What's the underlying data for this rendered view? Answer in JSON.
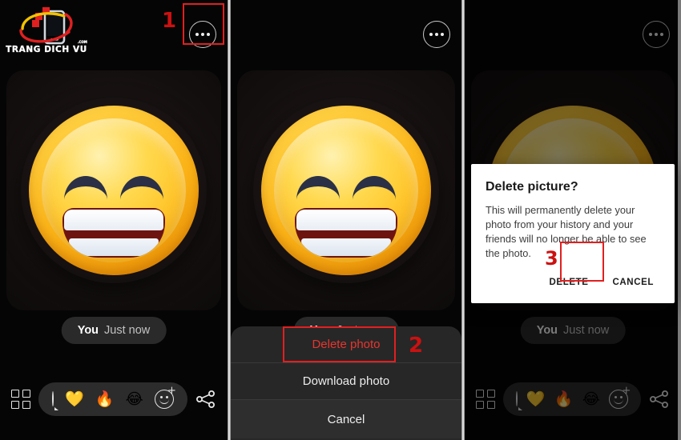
{
  "watermark": {
    "text": "TRANG DICH VU",
    "superscript": ".COM",
    "icon": "mobile-phone-logo"
  },
  "panels": [
    {
      "id": "panel-1",
      "step": "1",
      "menu_icon": "more-options-icon",
      "photo": {
        "alt": "grinning-face-with-smiling-eyes-emoji",
        "author": "You",
        "timestamp": "Just now"
      },
      "action_bar": {
        "grid_icon": "grid-view-icon",
        "reactions": [
          {
            "name": "comment-bubble-icon",
            "glyph": ""
          },
          {
            "name": "yellow-heart-reaction",
            "glyph": "💛"
          },
          {
            "name": "fire-reaction",
            "glyph": "🔥"
          },
          {
            "name": "joy-reaction",
            "glyph": "😂"
          },
          {
            "name": "add-reaction-icon",
            "glyph": ""
          }
        ],
        "share_icon": "share-icon"
      }
    },
    {
      "id": "panel-2",
      "step": "2",
      "menu_icon": "more-options-icon",
      "photo": {
        "alt": "grinning-face-with-smiling-eyes-emoji",
        "author": "You",
        "timestamp": "Just now"
      },
      "bottom_sheet": {
        "items": [
          {
            "label": "Delete photo",
            "style": "danger"
          },
          {
            "label": "Download photo",
            "style": "normal"
          },
          {
            "label": "Cancel",
            "style": "normal"
          }
        ]
      }
    },
    {
      "id": "panel-3",
      "step": "3",
      "menu_icon": "more-options-icon",
      "photo": {
        "alt": "grinning-face-with-smiling-eyes-emoji",
        "author": "You",
        "timestamp": "Just now"
      },
      "dialog": {
        "title": "Delete picture?",
        "body": "This will permanently delete your photo from your history and your friends will no longer be able to see the photo.",
        "confirm_label": "DELETE",
        "cancel_label": "CANCEL"
      },
      "action_bar": {
        "grid_icon": "grid-view-icon",
        "reactions": [
          {
            "name": "comment-bubble-icon",
            "glyph": ""
          },
          {
            "name": "yellow-heart-reaction",
            "glyph": "💛"
          },
          {
            "name": "fire-reaction",
            "glyph": "🔥"
          },
          {
            "name": "joy-reaction",
            "glyph": "😂"
          },
          {
            "name": "add-reaction-icon",
            "glyph": ""
          }
        ],
        "share_icon": "share-icon"
      }
    }
  ],
  "colors": {
    "annotation_red": "#e02020",
    "annotation_number_red": "#cc1111",
    "danger_text": "#e8352e",
    "panel_background": "#050505",
    "sheet_background": "#272727",
    "dialog_background": "#ffffff"
  }
}
